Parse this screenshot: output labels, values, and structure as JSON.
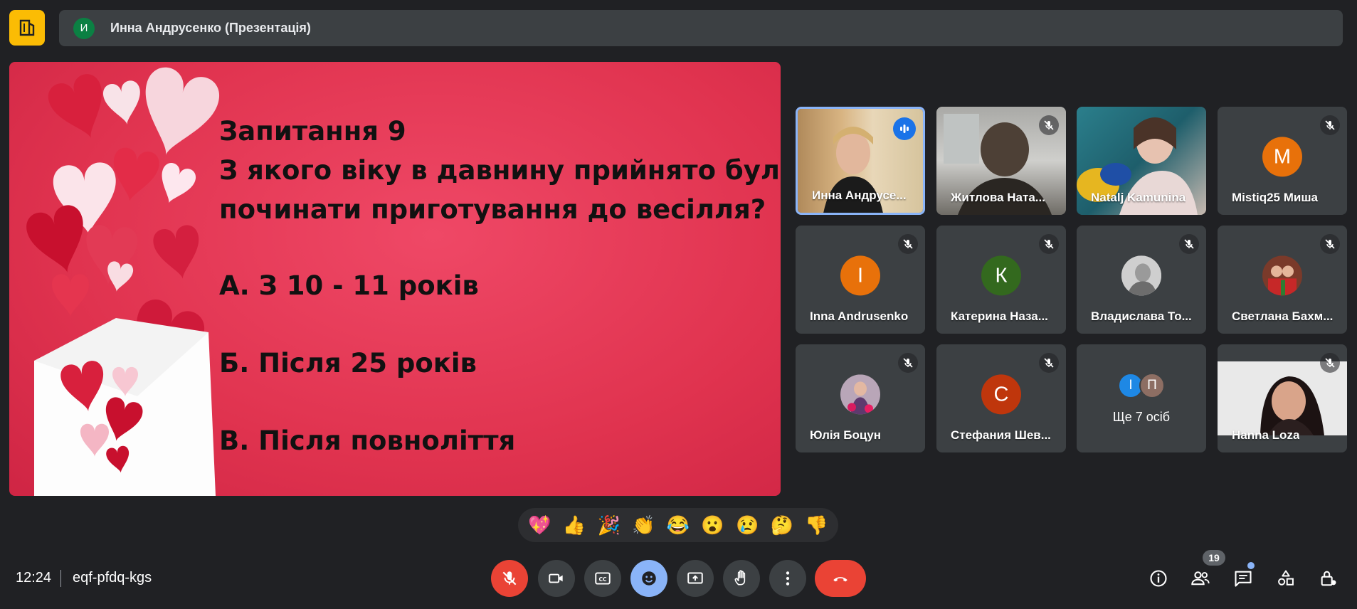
{
  "header": {
    "presenter_initial": "И",
    "presenter_title": "Инна Андрусенко (Презентація)"
  },
  "slide": {
    "lines": [
      "Запитання 9",
      "З якого віку в давнину прийнято було",
      "починати приготування до весілля?"
    ],
    "answers": [
      "А. З 10 - 11 років",
      "Б. Після 25 років",
      "В. Після повноліття"
    ]
  },
  "participants": [
    {
      "name": "Инна Андрусе...",
      "type": "video",
      "speaking": true
    },
    {
      "name": "Житлова Ната...",
      "type": "video",
      "muted": true
    },
    {
      "name": "Natalj Kamunina",
      "type": "video"
    },
    {
      "name": "Mistiq25 Миша",
      "type": "initial",
      "initial": "M",
      "color": "#e8710a",
      "muted": true
    },
    {
      "name": "Inna Andrusenko",
      "type": "initial",
      "initial": "I",
      "color": "#e8710a",
      "muted": true
    },
    {
      "name": "Катерина Наза...",
      "type": "initial",
      "initial": "К",
      "color": "#33691e",
      "muted": true
    },
    {
      "name": "Владислава То...",
      "type": "photo",
      "muted": true
    },
    {
      "name": "Светлана Бахм...",
      "type": "photo",
      "muted": true
    },
    {
      "name": "Юлія Боцун",
      "type": "photo",
      "muted": true
    },
    {
      "name": "Стефания Шев...",
      "type": "initial",
      "initial": "С",
      "color": "#bf360c",
      "muted": true
    },
    {
      "name": "Ще 7 осіб",
      "type": "more",
      "initials": [
        "I",
        "П"
      ],
      "colors": [
        "#1e88e5",
        "#8d6e63"
      ]
    },
    {
      "name": "Hanna Loza",
      "type": "video",
      "muted": true
    }
  ],
  "reactions": [
    "💖",
    "👍",
    "🎉",
    "👏",
    "😂",
    "😮",
    "😢",
    "🤔",
    "👎"
  ],
  "footer": {
    "time": "12:24",
    "meeting_code": "eqf-pfdq-kgs",
    "participant_count": "19"
  },
  "colors": {
    "background": "#202124",
    "tile": "#3c4043",
    "accent_blue": "#8ab4f8",
    "danger_red": "#ea4335",
    "slide_red": "#e0334f"
  }
}
